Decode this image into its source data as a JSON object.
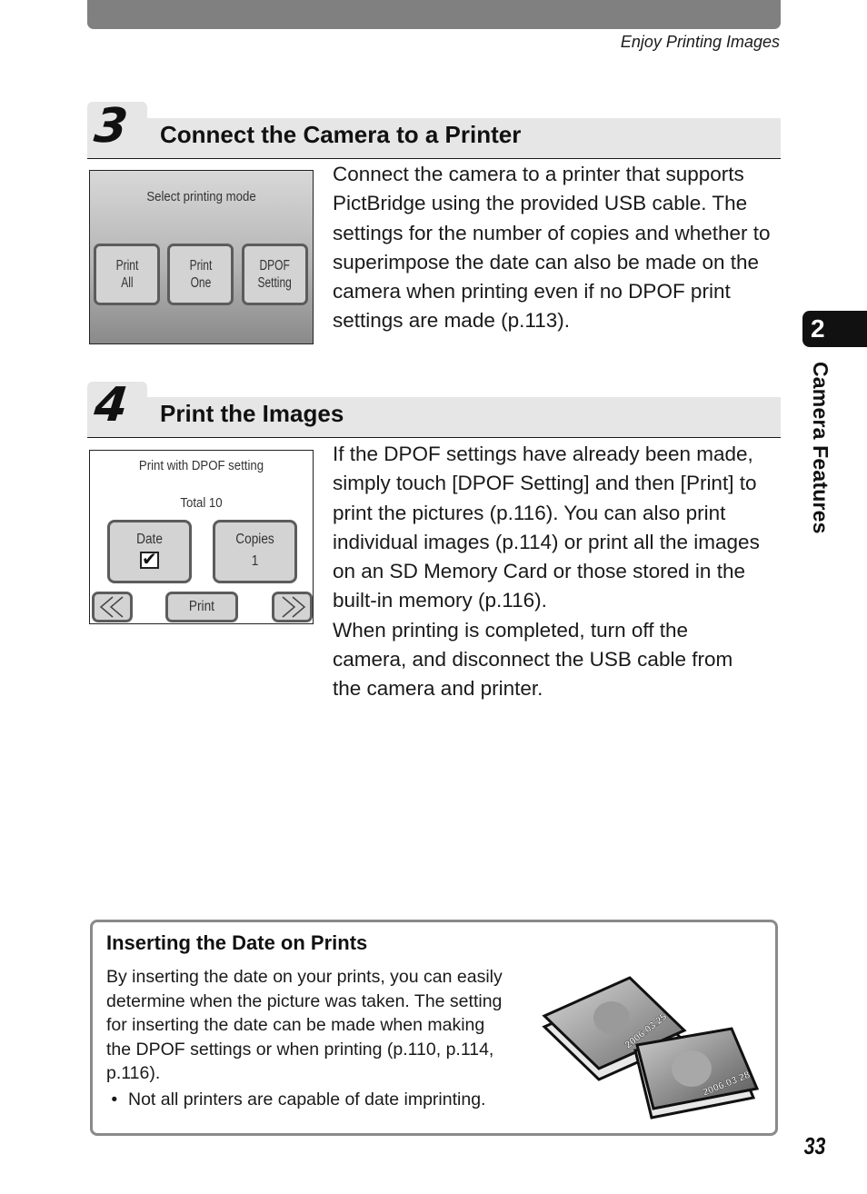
{
  "header": {
    "running_head": "Enjoy Printing Images"
  },
  "steps": [
    {
      "number": "3",
      "title": "Connect the Camera to a Printer",
      "body": "Connect the camera to a printer that supports PictBridge using the provided USB cable. The settings for the number of copies and whether to superimpose the date can also be made on the camera when printing even if no DPOF print settings are made (p.113).",
      "screen": {
        "title": "Select printing mode",
        "buttons": [
          {
            "line1": "Print",
            "line2": "All"
          },
          {
            "line1": "Print",
            "line2": "One"
          },
          {
            "line1": "DPOF",
            "line2": "Setting"
          }
        ]
      }
    },
    {
      "number": "4",
      "title": "Print the Images",
      "body_lines": [
        "If the DPOF settings have already been made,",
        "simply touch [DPOF Setting] and then [Print] to",
        "print the pictures (p.116). You can also print",
        "individual images (p.114) or print all the images",
        "on an SD Memory Card or those stored in the",
        "built-in memory (p.116).",
        "When printing is completed, turn off the",
        "camera, and disconnect the USB cable from",
        "the camera and printer."
      ],
      "screen": {
        "title": "Print with DPOF setting",
        "total": "Total  10",
        "date_label": "Date",
        "date_checked": true,
        "copies_label": "Copies",
        "copies_value": "1",
        "print_label": "Print",
        "prev_icon": "double-chevron-left",
        "next_icon": "double-chevron-right"
      }
    }
  ],
  "sidebar": {
    "chapter_number": "2",
    "chapter_name": "Camera Features"
  },
  "info_box": {
    "title": "Inserting the Date on Prints",
    "body_lines": [
      "By inserting the date on your prints, you can easily",
      "determine when the picture was taken. The setting",
      "for inserting the date can be made when making",
      "the DPOF settings or when printing (p.110, p.114,",
      "p.116)."
    ],
    "bullet": "Not all printers are capable of date imprinting.",
    "illustration": {
      "photo1_date": "2006.03.25",
      "photo2_date": "2006.03.28"
    }
  },
  "footer": {
    "page_number": "33"
  }
}
